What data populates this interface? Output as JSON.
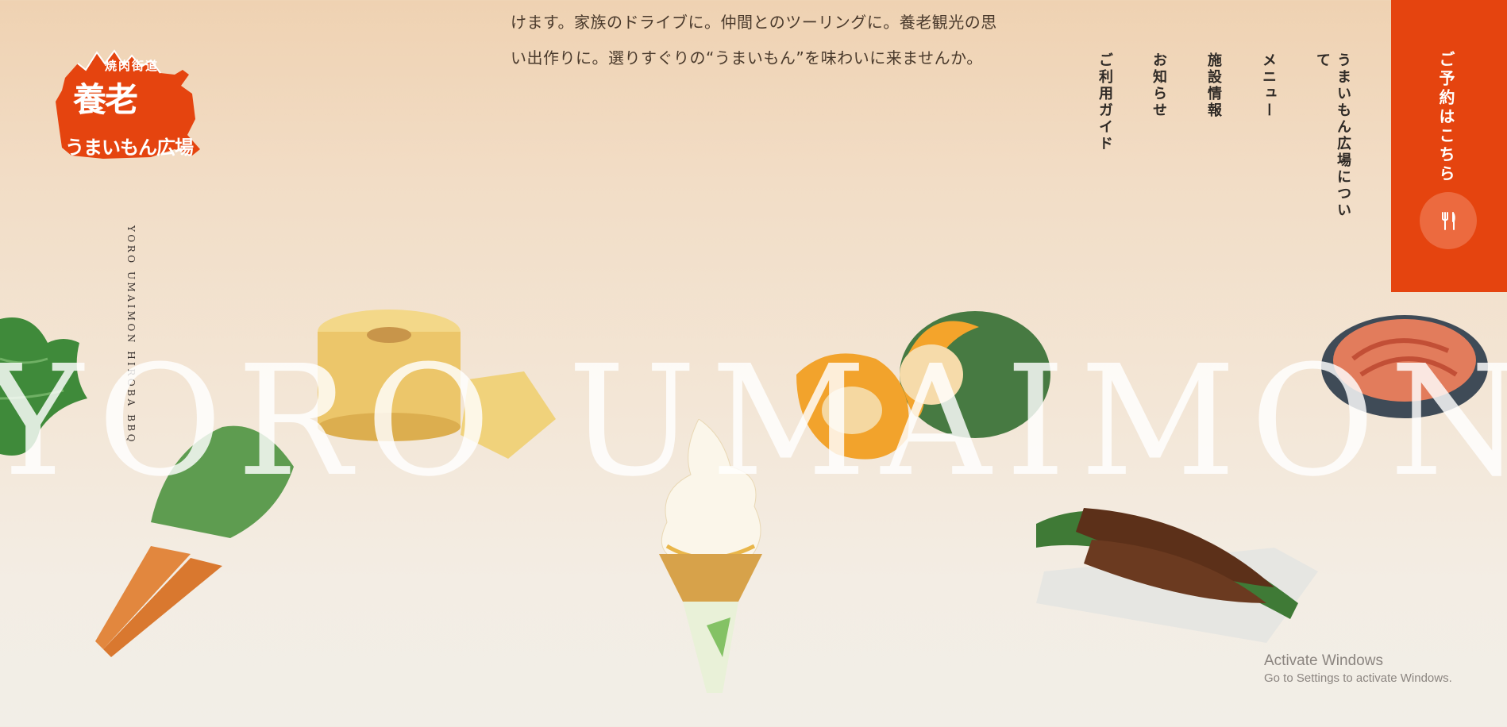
{
  "intro": {
    "line1": "けます。家族のドライブに。仲間とのツーリングに。養老観光の思",
    "line2": "い出作りに。選りすぐりの“うまいもん”を味わいに来ませんか。"
  },
  "logo": {
    "top": "焼肉街道",
    "main": "養老",
    "bottom": "うまいもん広場"
  },
  "vertical_brand": "YORO UMAIMON HIROBA BBQ",
  "nav": [
    {
      "label": "うまいもん広場について"
    },
    {
      "label": "メニュー"
    },
    {
      "label": "施設情報"
    },
    {
      "label": "お知らせ"
    },
    {
      "label": "ご利用ガイド"
    }
  ],
  "reserve": {
    "label": "ご予約はこちら",
    "icon": "fork-knife-icon"
  },
  "hero_word": "YORO UMAIMON",
  "colors": {
    "accent": "#e5440f",
    "accent_light": "#ec6a3f",
    "text": "#2f2a26"
  },
  "watermark": {
    "title": "Activate Windows",
    "subtitle": "Go to Settings to activate Windows."
  }
}
